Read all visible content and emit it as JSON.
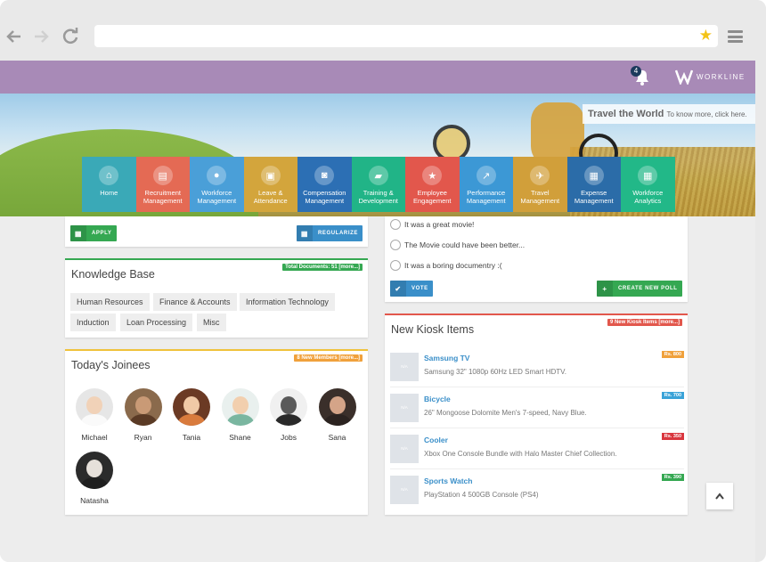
{
  "browser": {
    "back_icon": "arrow-left-icon",
    "forward_icon": "arrow-right-icon",
    "reload_icon": "reload-icon",
    "url": "",
    "menu_icon": "hamburger-menu-icon"
  },
  "header": {
    "notifications_count": "4",
    "brand": "WORKLINE",
    "accent": "#a88ab7"
  },
  "banner": {
    "title": "Travel the World",
    "subtitle": "To know more, click here."
  },
  "modules": [
    {
      "label": "Home",
      "icon": "home-icon",
      "color": "#3aa9b7"
    },
    {
      "label": "Recruitment Management",
      "icon": "document-icon",
      "color": "#e46a54"
    },
    {
      "label": "Workforce Management",
      "icon": "user-icon",
      "color": "#4a9fd8"
    },
    {
      "label": "Leave & Attendance",
      "icon": "briefcase-icon",
      "color": "#d3a53c"
    },
    {
      "label": "Compensation Management",
      "icon": "money-icon",
      "color": "#2c6fb4"
    },
    {
      "label": "Training & Development",
      "icon": "book-icon",
      "color": "#21b487"
    },
    {
      "label": "Employee Engagement",
      "icon": "star-icon",
      "color": "#e2574c"
    },
    {
      "label": "Performance Management",
      "icon": "chart-icon",
      "color": "#3c98d5"
    },
    {
      "label": "Travel Management",
      "icon": "plane-icon",
      "color": "#d19f3a"
    },
    {
      "label": "Expense Management",
      "icon": "calculator-icon",
      "color": "#2b6ca8"
    },
    {
      "label": "Workforce Analytics",
      "icon": "calculator-icon",
      "color": "#22b888"
    }
  ],
  "leave": {
    "apply_label": "APPLY",
    "regularize_label": "REGULARIZE"
  },
  "knowledge": {
    "title": "Knowledge Base",
    "badge": "Total Documents: 51 [more...]",
    "tags": [
      "Human Resources",
      "Finance & Accounts",
      "Information Technology",
      "Induction",
      "Loan Processing",
      "Misc"
    ]
  },
  "joinees": {
    "title": "Today's Joinees",
    "badge": "8 New Members [more...]",
    "people": [
      "Michael",
      "Ryan",
      "Tania",
      "Shane",
      "Jobs",
      "Sana",
      "Natasha"
    ]
  },
  "poll": {
    "options": [
      "It was a great movie!",
      "The Movie could have been better...",
      "It was a boring documentry :("
    ],
    "vote_label": "VOTE",
    "create_label": "CREATE NEW POLL"
  },
  "kiosk": {
    "title": "New Kiosk Items",
    "badge": "9 New Kiosk Items [more...]",
    "thumb_label": "N/A",
    "items": [
      {
        "name": "Samsung TV",
        "desc": "Samsung 32\" 1080p 60Hz LED Smart HDTV.",
        "price": "Rs. 800",
        "color": "#f0a13c"
      },
      {
        "name": "Bicycle",
        "desc": "26\" Mongoose Dolomite Men's 7-speed, Navy Blue.",
        "price": "Rs. 700",
        "color": "#3aa3d8"
      },
      {
        "name": "Cooler",
        "desc": "Xbox One Console Bundle with Halo Master Chief Collection.",
        "price": "Rs. 350",
        "color": "#d9363e"
      },
      {
        "name": "Sports Watch",
        "desc": "PlayStation 4 500GB Console (PS4)",
        "price": "Rs. 390",
        "color": "#35a852"
      }
    ]
  }
}
